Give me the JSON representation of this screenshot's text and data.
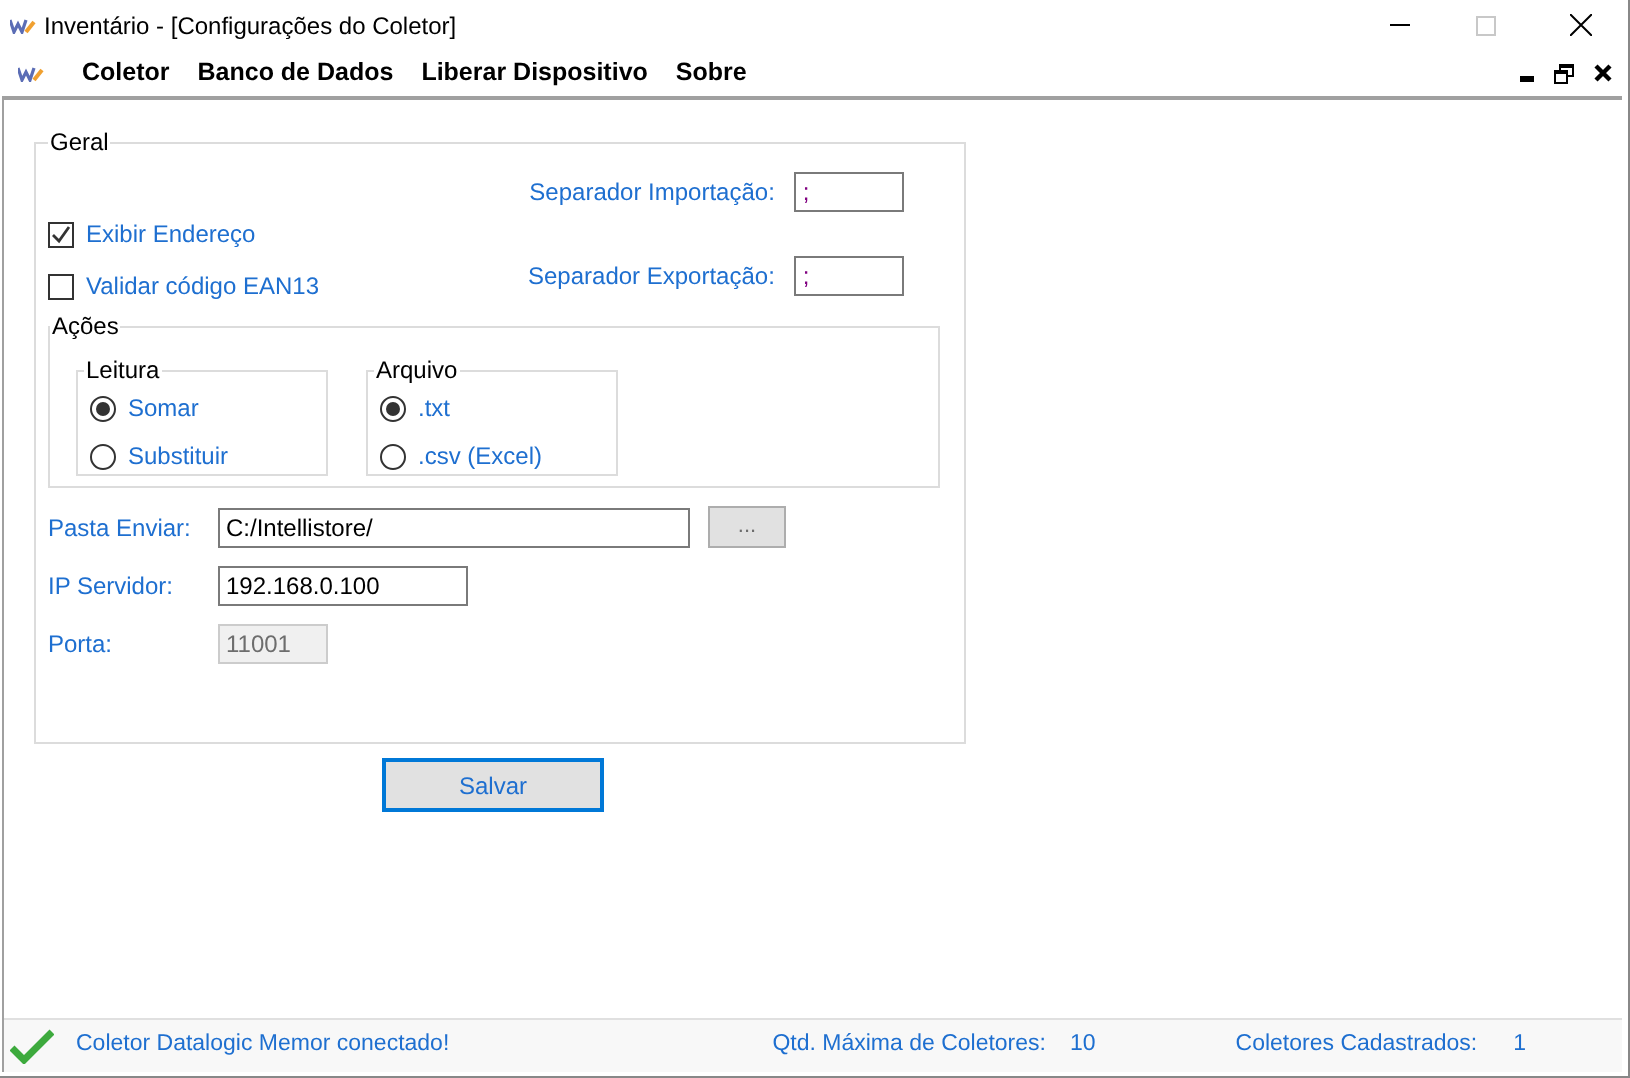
{
  "window": {
    "title": "Inventário - [Configurações do Coletor]"
  },
  "menu": [
    {
      "label": "Coletor"
    },
    {
      "label": "Banco de Dados"
    },
    {
      "label": "Liberar Dispositivo"
    },
    {
      "label": "Sobre"
    }
  ],
  "general": {
    "title": "Geral",
    "checkboxes": [
      {
        "label": "Exibir Endereço",
        "checked": true
      },
      {
        "label": "Validar código EAN13",
        "checked": false
      }
    ],
    "separators": [
      {
        "label": "Separador Importação:",
        "value": ";"
      },
      {
        "label": "Separador Exportação:",
        "value": ";"
      }
    ],
    "actions": {
      "title": "Ações",
      "groups": [
        {
          "title": "Leitura",
          "options": [
            {
              "label": "Somar",
              "selected": true
            },
            {
              "label": "Substituir",
              "selected": false
            }
          ]
        },
        {
          "title": "Arquivo",
          "options": [
            {
              "label": ".txt",
              "selected": true
            },
            {
              "label": ".csv (Excel)",
              "selected": false
            }
          ]
        }
      ]
    },
    "fields": [
      {
        "label": "Pasta Enviar:",
        "value": "C:/Intellistore/",
        "disabled": false,
        "button": "..."
      },
      {
        "label": "IP Servidor:",
        "value": "192.168.0.100",
        "disabled": false
      },
      {
        "label": "Porta:",
        "value": "11001",
        "disabled": true
      }
    ]
  },
  "save_button": "Salvar",
  "status_bar": {
    "message": "Coletor Datalogic Memor conectado!",
    "max_label": "Qtd. Máxima de Coletores:",
    "max_value": "10",
    "registered_label": "Coletores Cadastrados:",
    "registered_value": "1"
  }
}
